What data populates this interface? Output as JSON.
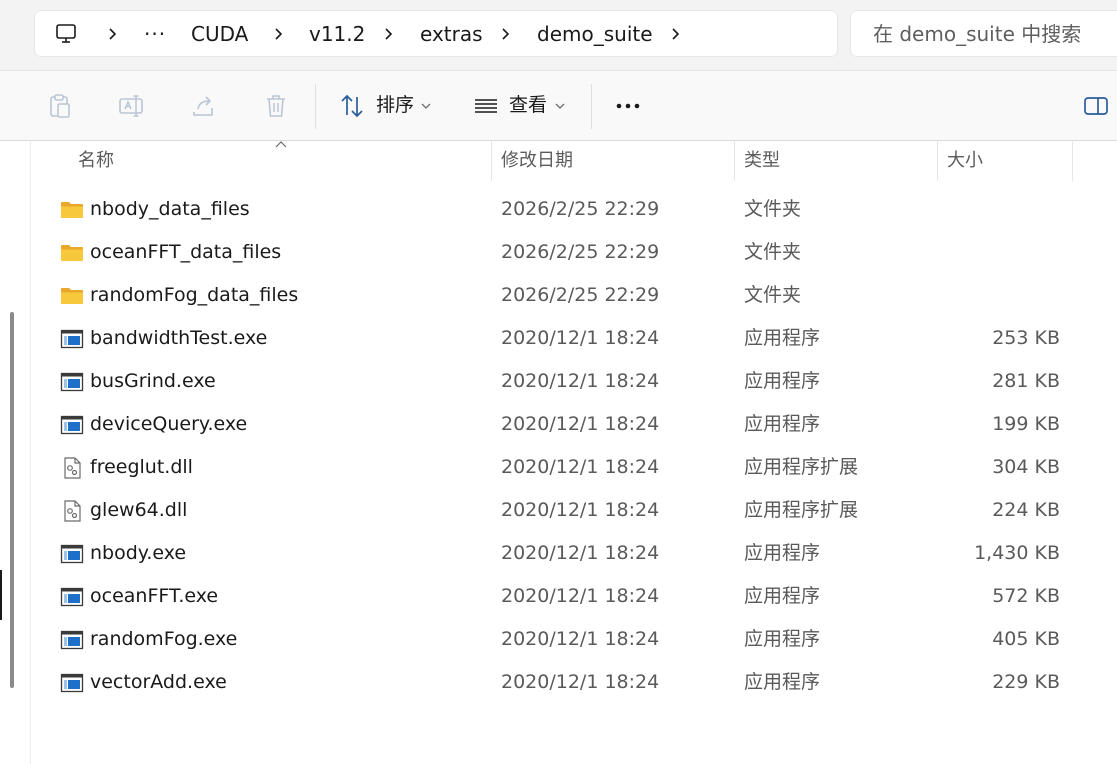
{
  "address": {
    "computer_icon": "computer-icon",
    "more": "···",
    "crumbs": [
      "CUDA",
      "v11.2",
      "extras",
      "demo_suite"
    ]
  },
  "search": {
    "placeholder": "在 demo_suite 中搜索"
  },
  "toolbar": {
    "sort_label": "排序",
    "view_label": "查看",
    "more_label": "···"
  },
  "columns": {
    "name": "名称",
    "date": "修改日期",
    "type": "类型",
    "size": "大小"
  },
  "files": [
    {
      "name": "nbody_data_files",
      "date": "2026/2/25 22:29",
      "type": "文件夹",
      "size": "",
      "kind": "folder"
    },
    {
      "name": "oceanFFT_data_files",
      "date": "2026/2/25 22:29",
      "type": "文件夹",
      "size": "",
      "kind": "folder"
    },
    {
      "name": "randomFog_data_files",
      "date": "2026/2/25 22:29",
      "type": "文件夹",
      "size": "",
      "kind": "folder"
    },
    {
      "name": "bandwidthTest.exe",
      "date": "2020/12/1 18:24",
      "type": "应用程序",
      "size": "253 KB",
      "kind": "exe"
    },
    {
      "name": "busGrind.exe",
      "date": "2020/12/1 18:24",
      "type": "应用程序",
      "size": "281 KB",
      "kind": "exe"
    },
    {
      "name": "deviceQuery.exe",
      "date": "2020/12/1 18:24",
      "type": "应用程序",
      "size": "199 KB",
      "kind": "exe"
    },
    {
      "name": "freeglut.dll",
      "date": "2020/12/1 18:24",
      "type": "应用程序扩展",
      "size": "304 KB",
      "kind": "dll"
    },
    {
      "name": "glew64.dll",
      "date": "2020/12/1 18:24",
      "type": "应用程序扩展",
      "size": "224 KB",
      "kind": "dll"
    },
    {
      "name": "nbody.exe",
      "date": "2020/12/1 18:24",
      "type": "应用程序",
      "size": "1,430 KB",
      "kind": "exe"
    },
    {
      "name": "oceanFFT.exe",
      "date": "2020/12/1 18:24",
      "type": "应用程序",
      "size": "572 KB",
      "kind": "exe"
    },
    {
      "name": "randomFog.exe",
      "date": "2020/12/1 18:24",
      "type": "应用程序",
      "size": "405 KB",
      "kind": "exe"
    },
    {
      "name": "vectorAdd.exe",
      "date": "2020/12/1 18:24",
      "type": "应用程序",
      "size": "229 KB",
      "kind": "exe"
    }
  ],
  "colors": {
    "folder": "#F8C83C",
    "exe_accent": "#1E6FC8",
    "toolbar_bg": "#f9f9f9",
    "address_bg": "#f3f3f3"
  }
}
